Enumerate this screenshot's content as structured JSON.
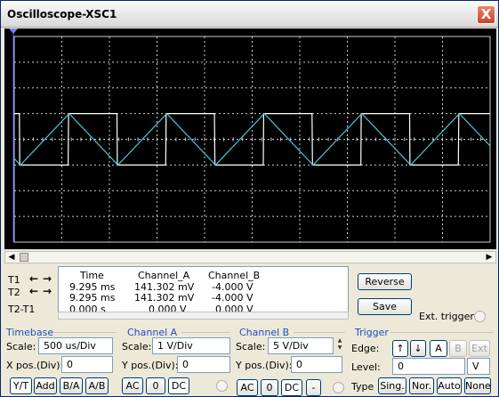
{
  "window": {
    "title": "Oscilloscope-XSC1",
    "close_label": "X"
  },
  "colors": {
    "grid": "#cccccc",
    "channel_a": "#ffffff",
    "channel_b": "#48c8d8",
    "screen": "#000000"
  },
  "readout": {
    "headers": [
      "Time",
      "Channel_A",
      "Channel_B"
    ],
    "rows": [
      {
        "label": "T1",
        "time": "9.295 ms",
        "a": "141.302 mV",
        "b": "-4.000 V"
      },
      {
        "label": "T2",
        "time": "9.295 ms",
        "a": "141.302 mV",
        "b": "-4.000 V"
      },
      {
        "label": "T2-T1",
        "time": "0.000 s",
        "a": "0.000 V",
        "b": "0.000 V"
      }
    ]
  },
  "buttons": {
    "reverse": "Reverse",
    "save": "Save"
  },
  "ext_trigger": "Ext. trigger",
  "timebase": {
    "title": "Timebase",
    "scale_label": "Scale:",
    "scale_value": "500 us/Div",
    "xpos_label": "X pos.(Div):",
    "xpos_value": "0",
    "modes": [
      "Y/T",
      "Add",
      "B/A",
      "A/B"
    ]
  },
  "channel_a": {
    "title": "Channel A",
    "scale_label": "Scale:",
    "scale_value": "1  V/Div",
    "ypos_label": "Y pos.(Div):",
    "ypos_value": "0",
    "coupling": [
      "AC",
      "0",
      "DC"
    ]
  },
  "channel_b": {
    "title": "Channel B",
    "scale_label": "Scale:",
    "scale_value": "5  V/Div",
    "ypos_label": "Y pos.(Div):",
    "ypos_value": "0",
    "coupling": [
      "AC",
      "0",
      "DC",
      "-"
    ]
  },
  "trigger": {
    "title": "Trigger",
    "edge_label": "Edge:",
    "edge_rise": "↑",
    "edge_fall": "↓",
    "sources": [
      "A",
      "B",
      "Ext"
    ],
    "level_label": "Level:",
    "level_value": "0",
    "level_unit": "V",
    "type_label": "Type",
    "types": [
      "Sing.",
      "Nor.",
      "Auto",
      "None"
    ]
  },
  "chart_data": {
    "type": "line",
    "xlim": [
      0,
      10
    ],
    "ylim": [
      -4,
      4
    ],
    "series": [
      {
        "color": "#ffffff",
        "kind": "square",
        "period_div": 2.05,
        "phase_div": 1.14,
        "amplitude_div": 1.0,
        "offset_div": 0
      },
      {
        "color": "#48c8d8",
        "kind": "triangle",
        "period_div": 2.05,
        "phase_div": 0.13,
        "amplitude_div": 1.0,
        "offset_div": 0
      }
    ]
  }
}
